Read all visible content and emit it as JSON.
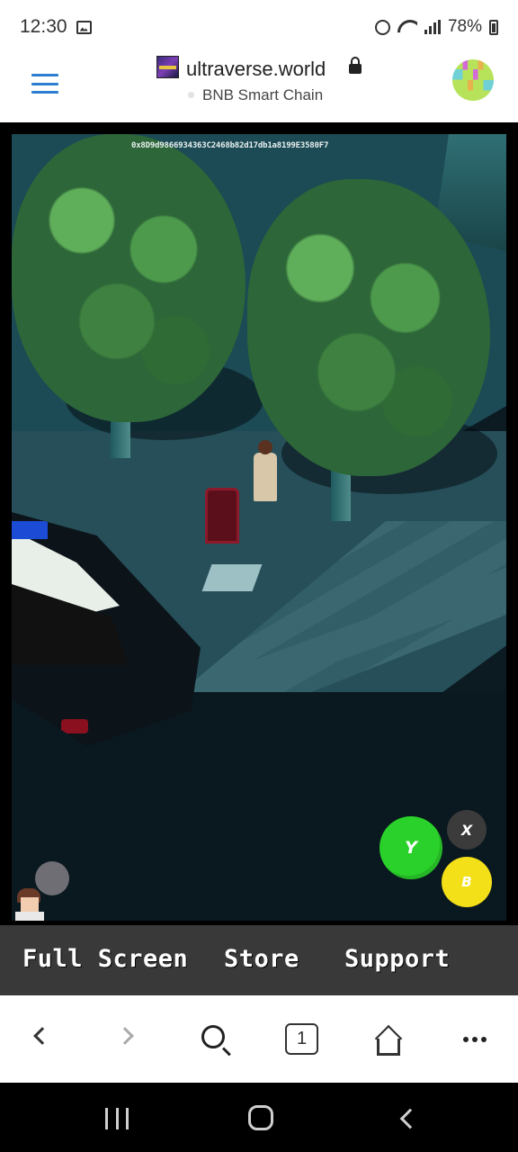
{
  "status_bar": {
    "time": "12:30",
    "battery": "78%",
    "icons": [
      "image-icon",
      "alarm-icon",
      "wifi-icon",
      "signal-icon",
      "battery-icon"
    ]
  },
  "browser": {
    "url": "ultraverse.world",
    "network": "BNB Smart Chain",
    "tab_count": "1",
    "icons": [
      "menu-icon",
      "lock-icon",
      "back-icon",
      "forward-icon",
      "search-icon",
      "tabs-icon",
      "home-icon",
      "more-icon"
    ]
  },
  "game": {
    "wallet_address": "0x8D9d9866934363C2468b82d17db1a8199E3580F7",
    "buttons": {
      "y": "Y",
      "x": "X",
      "b": "B"
    },
    "colors": {
      "y": "#2bd12b",
      "x": "#3b3b3b",
      "b": "#f3e019"
    }
  },
  "action_bar": {
    "full_screen": "Full Screen",
    "store": "Store",
    "support": "Support"
  },
  "android_nav": {
    "icons": [
      "recents-icon",
      "home-icon",
      "back-icon"
    ]
  }
}
